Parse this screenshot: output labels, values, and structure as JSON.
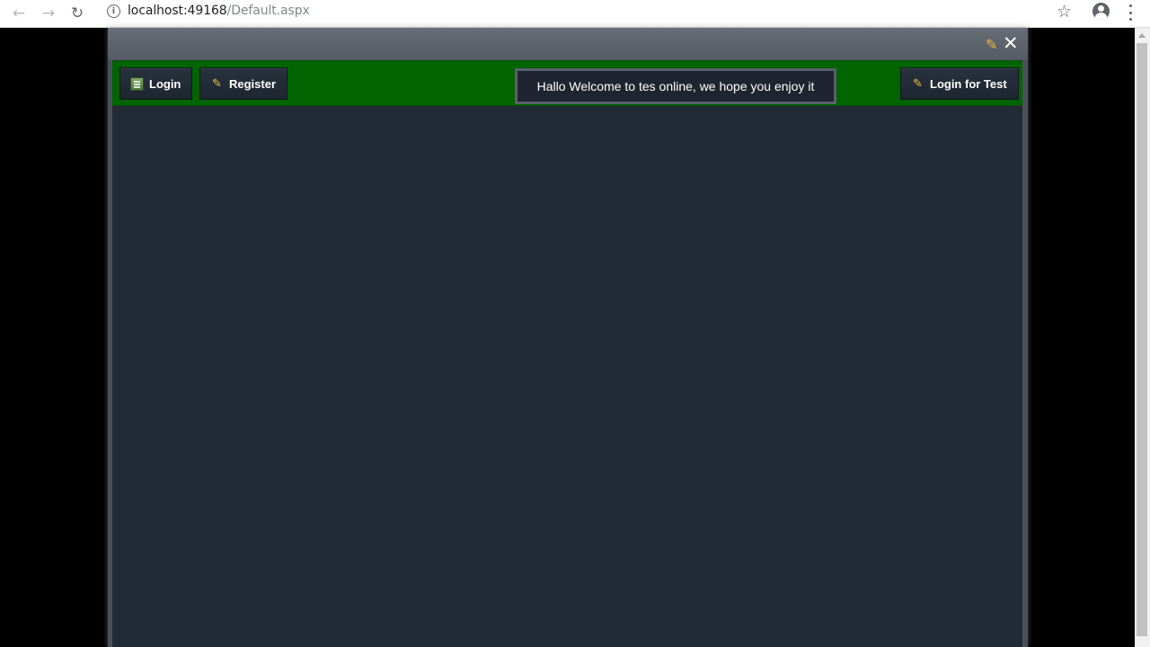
{
  "browser": {
    "url_host": "localhost:49168",
    "url_path": "/Default.aspx",
    "back_icon": "back-arrow-icon",
    "forward_icon": "forward-arrow-icon",
    "reload_icon": "reload-icon",
    "info_icon": "info-icon",
    "bookmark_icon": "star-icon",
    "profile_icon": "profile-icon",
    "menu_icon": "kebab-menu-icon"
  },
  "window": {
    "edit_icon": "pencil-icon",
    "close_icon": "close-icon"
  },
  "toolbar": {
    "login_label": "Login",
    "register_label": "Register",
    "login_test_label": "Login for Test",
    "color": "#006400"
  },
  "toast": {
    "message": "Hallo Welcome to tes online, we hope you enjoy it"
  }
}
